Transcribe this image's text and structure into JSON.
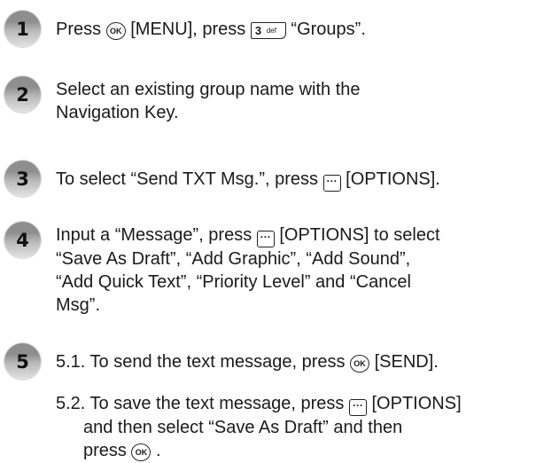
{
  "steps": [
    {
      "num": "1",
      "parts": [
        "Press",
        "[MENU], press",
        "“Groups”."
      ],
      "key3": {
        "digit": "3",
        "letters": "def"
      }
    },
    {
      "num": "2",
      "lines": [
        "Select an existing group name with the",
        "Navigation Key."
      ]
    },
    {
      "num": "3",
      "parts": [
        "To select “Send TXT Msg.”, press",
        "[OPTIONS]."
      ]
    },
    {
      "num": "4",
      "first": [
        "Input a “Message”, press",
        "[OPTIONS] to select"
      ],
      "lines": [
        "“Save As Draft”, “Add Graphic”, “Add Sound”,",
        "“Add Quick Text”, “Priority Level” and “Cancel",
        "Msg”."
      ]
    },
    {
      "num": "5",
      "sub1": [
        "5.1. To send the text message, press",
        "[SEND]."
      ],
      "sub2": {
        "first": [
          "5.2. To save the text message, press",
          "[OPTIONS]"
        ],
        "lines": [
          "and then select “Save As Draft” and then"
        ],
        "last": [
          "press",
          "."
        ]
      }
    }
  ],
  "icons": {
    "ok_label": "OK",
    "options_glyph": "···"
  }
}
